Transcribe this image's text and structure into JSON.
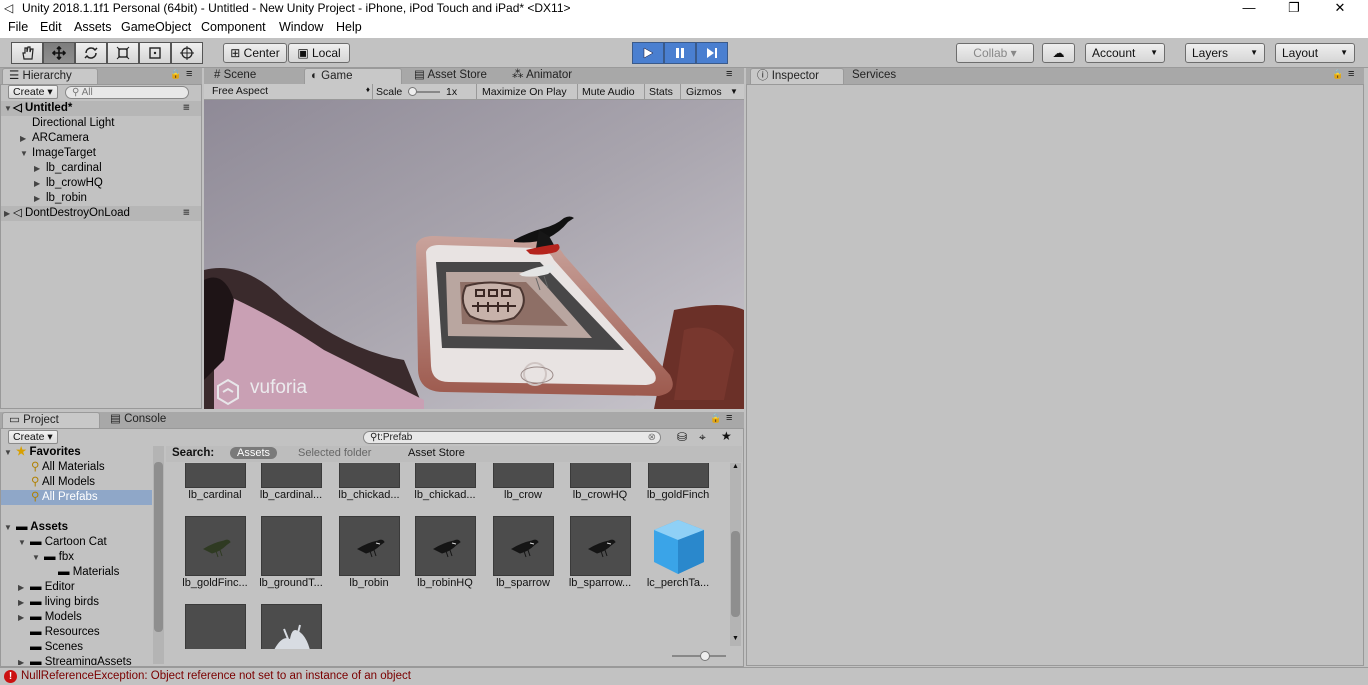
{
  "window": {
    "title": "Unity 2018.1.1f1 Personal (64bit) - Untitled - New Unity Project - iPhone, iPod Touch and iPad* <DX11>",
    "min": "—",
    "max": "❐",
    "close": "✕"
  },
  "menu": [
    "File",
    "Edit",
    "Assets",
    "GameObject",
    "Component",
    "Window",
    "Help"
  ],
  "toolbar": {
    "center": "Center",
    "local": "Local",
    "collab": "Collab ▾",
    "account": "Account",
    "layers": "Layers",
    "layout": "Layout"
  },
  "hierarchy": {
    "tab": "Hierarchy",
    "create": "Create ▾",
    "search_placeholder": "All",
    "scene": "Untitled*",
    "items": [
      "Directional Light",
      "ARCamera",
      "ImageTarget",
      "lb_cardinal",
      "lb_crowHQ",
      "lb_robin"
    ],
    "ddol": "DontDestroyOnLoad"
  },
  "tabs": {
    "scene": "Scene",
    "game": "Game",
    "asset_store": "Asset Store",
    "animator": "Animator",
    "inspector": "Inspector",
    "services": "Services",
    "project": "Project",
    "console": "Console"
  },
  "game_toolbar": {
    "aspect": "Free Aspect",
    "scale_label": "Scale",
    "scale_value": "1x",
    "maximize": "Maximize On Play",
    "mute": "Mute Audio",
    "stats": "Stats",
    "gizmos": "Gizmos"
  },
  "viewport": {
    "watermark": "vuforia"
  },
  "project": {
    "create": "Create ▾",
    "search_value": "t:Prefab",
    "search_label": "Search:",
    "filter_assets": "Assets",
    "filter_selected": "Selected folder",
    "filter_store": "Asset Store",
    "favorites": {
      "header": "Favorites",
      "items": [
        "All Materials",
        "All Models",
        "All Prefabs"
      ]
    },
    "assets": {
      "header": "Assets",
      "items": [
        "Cartoon Cat",
        "fbx",
        "Materials",
        "Editor",
        "living birds",
        "Models",
        "Resources",
        "Scenes",
        "StreamingAssets"
      ]
    },
    "row1": [
      "lb_cardinal",
      "lb_cardinal...",
      "lb_chickad...",
      "lb_chickad...",
      "lb_crow",
      "lb_crowHQ",
      "lb_goldFinch"
    ],
    "row2": [
      "lb_goldFinc...",
      "lb_groundT...",
      "lb_robin",
      "lb_robinHQ",
      "lb_sparrow",
      "lb_sparrow...",
      "lc_perchTa..."
    ]
  },
  "status": {
    "message": "NullReferenceException: Object reference not set to an instance of an object",
    "icon": "error-icon"
  },
  "colors": {
    "play_active": "#4a7fd0",
    "selection": "#8fa7c8",
    "error": "#cc1111"
  }
}
